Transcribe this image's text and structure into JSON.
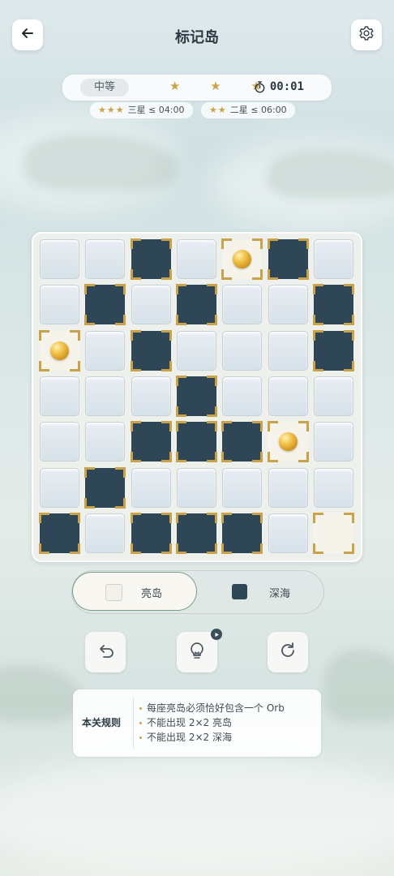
{
  "header": {
    "title": "标记岛"
  },
  "status": {
    "difficulty": "中等",
    "stars": "★ ★ ★",
    "timer": "00:01"
  },
  "goals": [
    {
      "stars": "★★★",
      "text": "三星 ≤ 04:00"
    },
    {
      "stars": "★★",
      "text": "二星 ≤ 06:00"
    }
  ],
  "board": {
    "rows": 7,
    "cols": 7,
    "legend": {
      "u": "unknown",
      "s": "deep-sea (marked)",
      "l": "light-island (marked)",
      "o": "light-island with orb"
    },
    "cells": [
      [
        "u",
        "u",
        "s",
        "u",
        "o",
        "s",
        "u"
      ],
      [
        "u",
        "s",
        "u",
        "s",
        "u",
        "u",
        "s"
      ],
      [
        "o",
        "u",
        "s",
        "u",
        "u",
        "u",
        "s"
      ],
      [
        "u",
        "u",
        "u",
        "s",
        "u",
        "u",
        "u"
      ],
      [
        "u",
        "u",
        "s",
        "s",
        "s",
        "o",
        "u"
      ],
      [
        "u",
        "s",
        "u",
        "u",
        "u",
        "u",
        "u"
      ],
      [
        "s",
        "u",
        "s",
        "s",
        "s",
        "u",
        "l"
      ]
    ]
  },
  "modes": {
    "light_label": "亮岛",
    "sea_label": "深海",
    "selected": "light"
  },
  "tools": {
    "undo": "undo-icon",
    "hint": "lightbulb-icon",
    "reset": "reset-icon"
  },
  "rules": {
    "title": "本关规则",
    "items": [
      "每座亮岛必须恰好包含一个 Orb",
      "不能出现 2×2 亮岛",
      "不能出现 2×2 深海"
    ]
  },
  "colors": {
    "accent_gold": "#c9a24a",
    "deep_sea": "#2e4656",
    "light_island": "#f6f3ea",
    "unknown": "#dde6ec"
  }
}
